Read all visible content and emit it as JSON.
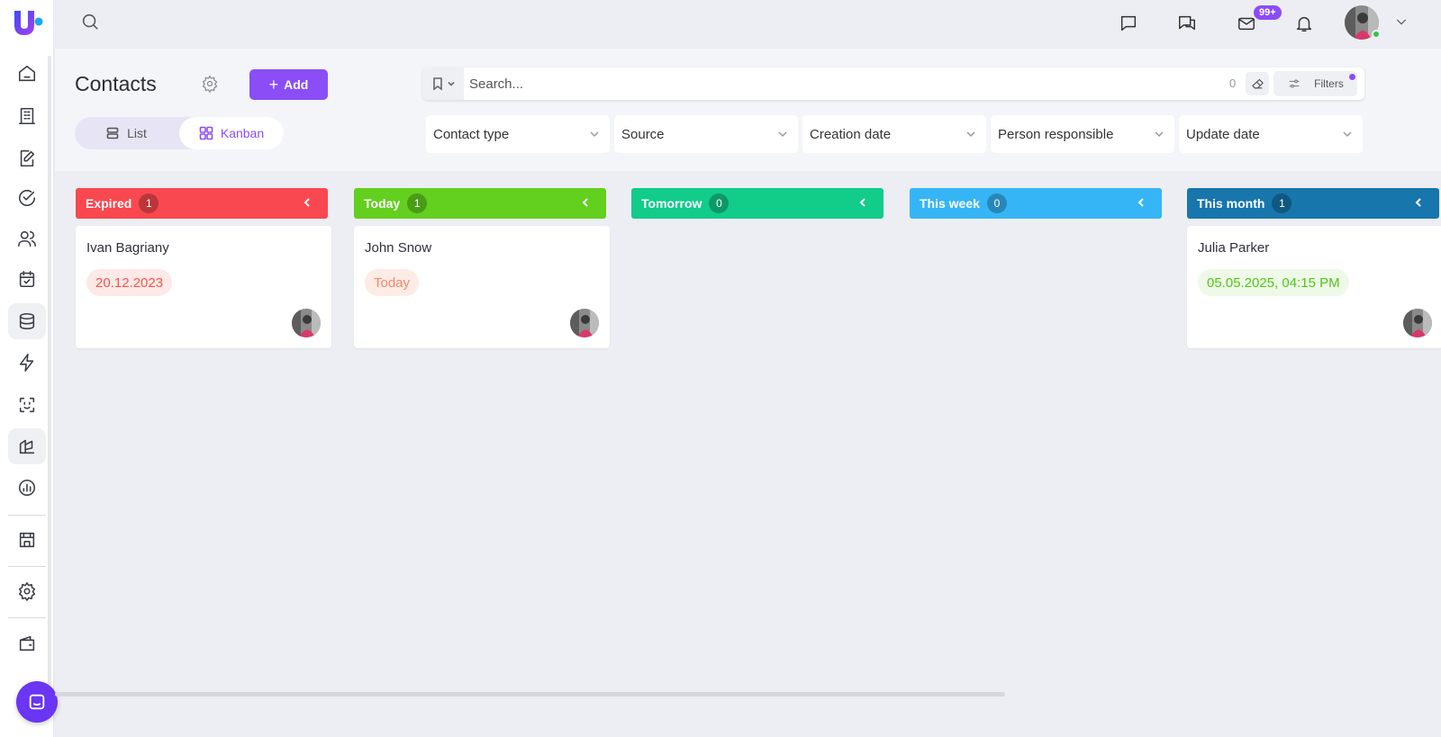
{
  "app": {
    "logo_letter": "U"
  },
  "sidebar": {
    "items": [
      {
        "icon": "home-icon"
      },
      {
        "icon": "building-icon"
      },
      {
        "icon": "edit-document-icon"
      },
      {
        "icon": "check-circle-icon"
      },
      {
        "icon": "users-icon"
      },
      {
        "icon": "calendar-check-icon"
      },
      {
        "icon": "database-icon"
      },
      {
        "icon": "lightning-icon"
      },
      {
        "icon": "scan-face-icon"
      },
      {
        "icon": "marketing-icon"
      },
      {
        "icon": "analytics-icon"
      },
      {
        "icon": "store-icon"
      },
      {
        "icon": "settings-icon"
      },
      {
        "icon": "wallet-icon"
      }
    ]
  },
  "topbar": {
    "mail_badge": "99+"
  },
  "page": {
    "title": "Contacts",
    "add_label": "Add",
    "views": {
      "list": "List",
      "kanban": "Kanban"
    }
  },
  "search": {
    "placeholder": "Search...",
    "count": "0",
    "filters_label": "Filters"
  },
  "filters": [
    "Contact type",
    "Source",
    "Creation date",
    "Person responsible",
    "Update date"
  ],
  "colors": {
    "accent": "#8a4df6",
    "expired": "#f9484f",
    "today": "#63cf1e",
    "tomorrow": "#12cc8a",
    "this_week": "#36b5f6",
    "this_month": "#1776ac"
  },
  "columns": [
    {
      "title": "Expired",
      "count": "1",
      "color": "#f9484f",
      "cards": [
        {
          "name": "Ivan Bagriany",
          "date": "20.12.2023",
          "date_color": "#f2564f",
          "date_bg": "#fde9e7"
        }
      ]
    },
    {
      "title": "Today",
      "count": "1",
      "color": "#63cf1e",
      "cards": [
        {
          "name": "John Snow",
          "date": "Today",
          "date_color": "#ef8a6c",
          "date_bg": "#fdebe6"
        }
      ]
    },
    {
      "title": "Tomorrow",
      "count": "0",
      "color": "#12cc8a",
      "cards": []
    },
    {
      "title": "This week",
      "count": "0",
      "color": "#36b5f6",
      "cards": []
    },
    {
      "title": "This month",
      "count": "1",
      "color": "#1776ac",
      "cards": [
        {
          "name": "Julia Parker",
          "date": "05.05.2025, 04:15 PM",
          "date_color": "#52c41a",
          "date_bg": "#eef9e7"
        }
      ]
    }
  ]
}
